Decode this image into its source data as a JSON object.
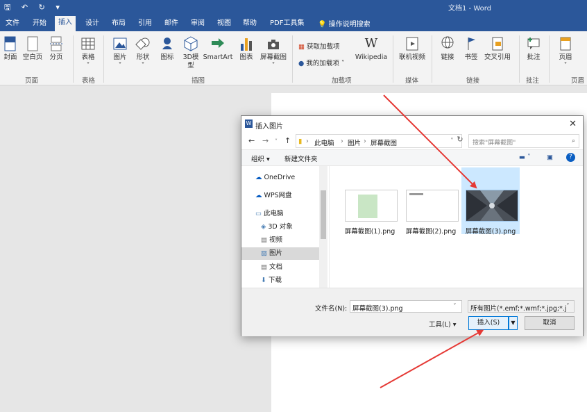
{
  "titlebar": {
    "title": "文档1 - Word"
  },
  "tabs": [
    {
      "label": "文件"
    },
    {
      "label": "开始"
    },
    {
      "label": "插入"
    },
    {
      "label": "设计"
    },
    {
      "label": "布局"
    },
    {
      "label": "引用"
    },
    {
      "label": "邮件"
    },
    {
      "label": "审阅"
    },
    {
      "label": "视图"
    },
    {
      "label": "帮助"
    },
    {
      "label": "PDF工具集"
    }
  ],
  "tell_me": "操作说明搜索",
  "ribbon": {
    "buttons": {
      "cover": "封面",
      "blank": "空白页",
      "break": "分页",
      "table": "表格",
      "pictures": "图片",
      "shapes": "形状",
      "icons": "图标",
      "model3d": "3D模型",
      "smartart": "SmartArt",
      "chart": "图表",
      "screenshot": "屏幕截图",
      "get_addins": "获取加载项",
      "my_addins": "我的加载项",
      "wikipedia": "Wikipedia",
      "online_video": "联机视频",
      "link": "链接",
      "bookmark": "书签",
      "crossref": "交叉引用",
      "comment": "批注",
      "header": "页眉"
    },
    "groups": {
      "pages": "页面",
      "tables": "表格",
      "illustrations": "插图",
      "addins": "加载项",
      "media": "媒体",
      "links": "链接",
      "comments": "批注",
      "header_footer": "页眉和"
    }
  },
  "dialog": {
    "title": "插入图片",
    "address": [
      "此电脑",
      "图片",
      "屏幕截图"
    ],
    "search_placeholder": "搜索\"屏幕截图\"",
    "organize": "组织 ▾",
    "new_folder": "新建文件夹",
    "nav_items": [
      "OneDrive",
      "WPS网盘",
      "此电脑",
      "3D 对象",
      "视频",
      "图片",
      "文档",
      "下载"
    ],
    "files": [
      "屏幕截图(1).png",
      "屏幕截图(2).png",
      "屏幕截图(3).png"
    ],
    "filename_label": "文件名(N):",
    "filename_value": "屏幕截图(3).png",
    "filetype_value": "所有图片(*.emf;*.wmf;*.jpg;*.jp",
    "tools_label": "工具(L)",
    "insert_label": "插入(S)",
    "cancel_label": "取消"
  }
}
